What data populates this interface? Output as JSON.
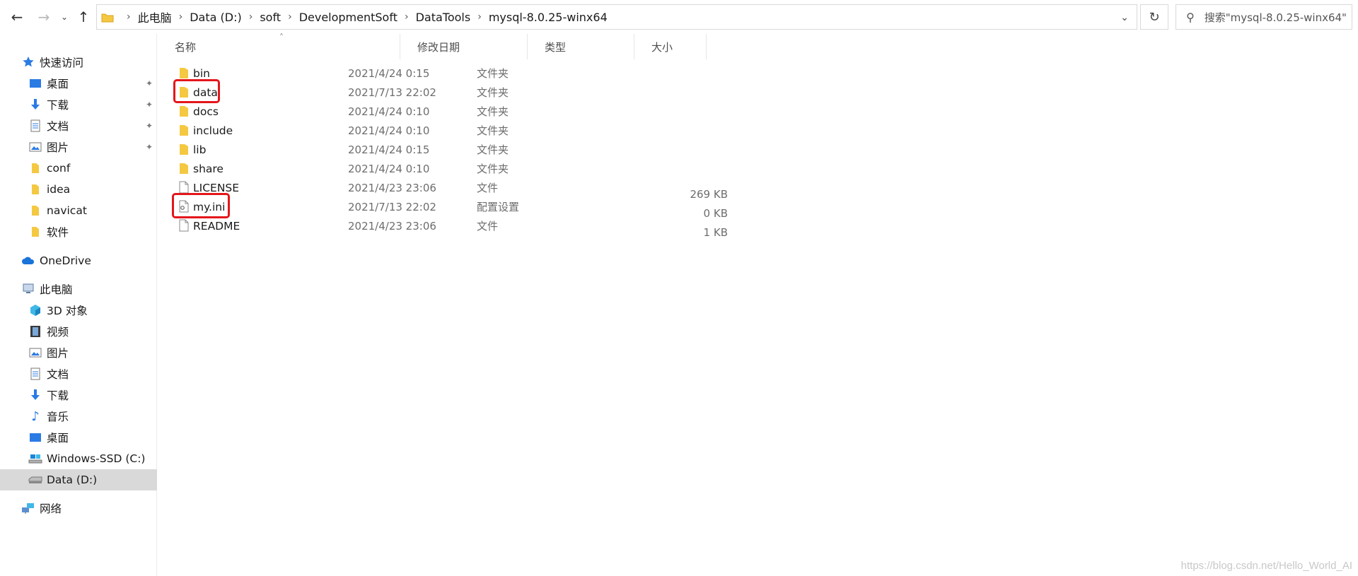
{
  "address": {
    "crumbs": [
      "此电脑",
      "Data (D:)",
      "soft",
      "DevelopmentSoft",
      "DataTools",
      "mysql-8.0.25-winx64"
    ]
  },
  "search": {
    "placeholder": "搜索\"mysql-8.0.25-winx64\""
  },
  "sidebar": {
    "quick_access": "快速访问",
    "quick_items": [
      {
        "label": "桌面",
        "icon": "desktop-icon",
        "pinned": true
      },
      {
        "label": "下载",
        "icon": "download-icon",
        "pinned": true
      },
      {
        "label": "文档",
        "icon": "document-icon",
        "pinned": true
      },
      {
        "label": "图片",
        "icon": "picture-icon",
        "pinned": true
      },
      {
        "label": "conf",
        "icon": "folder-icon",
        "pinned": false
      },
      {
        "label": "idea",
        "icon": "folder-icon",
        "pinned": false
      },
      {
        "label": "navicat",
        "icon": "folder-icon",
        "pinned": false
      },
      {
        "label": "软件",
        "icon": "folder-icon",
        "pinned": false
      }
    ],
    "onedrive": "OneDrive",
    "this_pc": "此电脑",
    "pc_items": [
      {
        "label": "3D 对象",
        "icon": "3d-objects-icon"
      },
      {
        "label": "视频",
        "icon": "video-icon"
      },
      {
        "label": "图片",
        "icon": "picture-icon"
      },
      {
        "label": "文档",
        "icon": "document-icon"
      },
      {
        "label": "下载",
        "icon": "download-icon"
      },
      {
        "label": "音乐",
        "icon": "music-icon"
      },
      {
        "label": "桌面",
        "icon": "desktop-icon"
      },
      {
        "label": "Windows-SSD (C:)",
        "icon": "ssd-drive-icon"
      },
      {
        "label": "Data (D:)",
        "icon": "drive-icon",
        "selected": true
      }
    ],
    "network": "网络"
  },
  "columns": {
    "name": "名称",
    "date": "修改日期",
    "type": "类型",
    "size": "大小"
  },
  "files": [
    {
      "name": "bin",
      "date": "2021/4/24 0:15",
      "type": "文件夹",
      "size": "",
      "icon": "folder-icon"
    },
    {
      "name": "data",
      "date": "2021/7/13 22:02",
      "type": "文件夹",
      "size": "",
      "icon": "folder-icon",
      "highlighted": true
    },
    {
      "name": "docs",
      "date": "2021/4/24 0:10",
      "type": "文件夹",
      "size": "",
      "icon": "folder-icon"
    },
    {
      "name": "include",
      "date": "2021/4/24 0:10",
      "type": "文件夹",
      "size": "",
      "icon": "folder-icon"
    },
    {
      "name": "lib",
      "date": "2021/4/24 0:15",
      "type": "文件夹",
      "size": "",
      "icon": "folder-icon"
    },
    {
      "name": "share",
      "date": "2021/4/24 0:10",
      "type": "文件夹",
      "size": "",
      "icon": "folder-icon"
    },
    {
      "name": "LICENSE",
      "date": "2021/4/23 23:06",
      "type": "文件",
      "size": "269 KB",
      "icon": "file-icon"
    },
    {
      "name": "my.ini",
      "date": "2021/7/13 22:02",
      "type": "配置设置",
      "size": "0 KB",
      "icon": "config-file-icon",
      "highlighted": true
    },
    {
      "name": "README",
      "date": "2021/4/23 23:06",
      "type": "文件",
      "size": "1 KB",
      "icon": "file-icon"
    }
  ],
  "watermark": "https://blog.csdn.net/Hello_World_AI",
  "colors": {
    "folder": "#f5c842",
    "highlight": "#e4161b",
    "selected_bg": "#d9d9d9",
    "accent_blue": "#1a73d9"
  }
}
